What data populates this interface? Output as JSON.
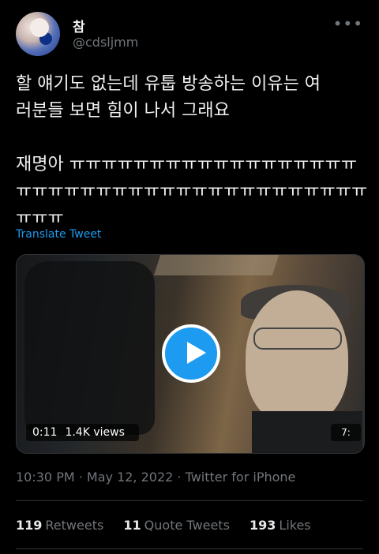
{
  "profile": {
    "name": "참",
    "handle": "@cdsljmm",
    "avatar_icon": "avatar-icon"
  },
  "tweet": {
    "text": "할 얘기도 없는데 유툽 방송하는 이유는 여\n러분들 보면 힘이 나서 그래요\n\n재명아 ㅠㅠㅠㅠㅠㅠㅠㅠㅠㅠㅠㅠㅠㅠㅠㅠㅠㅠ\nㅠㅠㅠㅠㅠㅠㅠㅠㅠㅠㅠㅠㅠㅠㅠㅠㅠㅠㅠㅠㅠㅠ\nㅠㅠㅠ",
    "translate_label": "Translate Tweet"
  },
  "video": {
    "timecode": "0:11",
    "views": "1.4K views",
    "live_indicator": "7:"
  },
  "meta": {
    "line": "10:30 PM · May 12, 2022 · Twitter for iPhone"
  },
  "stats": {
    "retweets_count": "119",
    "retweets_label": "Retweets",
    "quote_count": "11",
    "quote_label": "Quote Tweets",
    "likes_count": "193",
    "likes_label": "Likes"
  }
}
